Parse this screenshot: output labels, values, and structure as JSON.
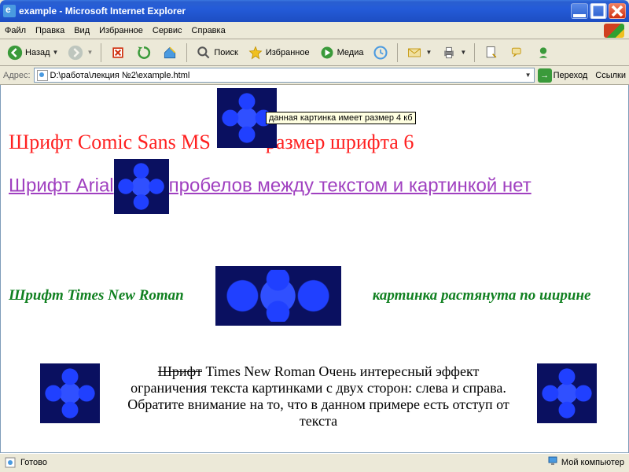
{
  "titlebar": {
    "title": "example - Microsoft Internet Explorer"
  },
  "menubar": {
    "file": "Файл",
    "edit": "Правка",
    "view": "Вид",
    "favorites": "Избранное",
    "tools": "Сервис",
    "help": "Справка"
  },
  "toolbar": {
    "back": "Назад",
    "search": "Поиск",
    "favorites": "Избранное",
    "media": "Медиа"
  },
  "addressbar": {
    "label": "Адрес:",
    "value": "D:\\работа\\лекция №2\\example.html",
    "go": "Переход",
    "links": "Ссылки"
  },
  "content": {
    "tooltip": "данная картинка имеет размер 4 кб",
    "comic_left": "Шрифт Comic Sans MS",
    "comic_right": "размер шрифта 6",
    "arial_left": "Шрифт Arial",
    "arial_right": "пробелов между текстом и картинкой нет",
    "times_left": "Шрифт Times New Roman",
    "times_right": "картинка растянута по ширине",
    "bottom_strike": "Шрифт",
    "bottom_text": " Times New Roman Очень интересный эффект ограничения текста картинками с двух сторон: слева и справа. Обратите внимание на то, что в данном примере есть отступ от текста"
  },
  "statusbar": {
    "ready": "Готово",
    "zone": "Мой компьютер"
  }
}
